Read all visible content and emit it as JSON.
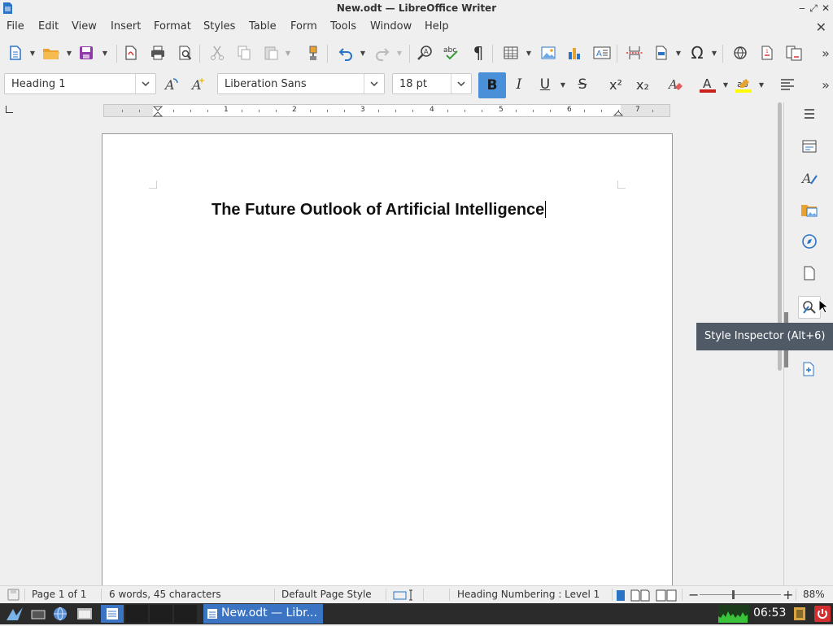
{
  "window": {
    "title": "New.odt — LibreOffice Writer"
  },
  "menubar": {
    "items": [
      "File",
      "Edit",
      "View",
      "Insert",
      "Format",
      "Styles",
      "Table",
      "Form",
      "Tools",
      "Window",
      "Help"
    ]
  },
  "formatting": {
    "paragraph_style": "Heading 1",
    "font_name": "Liberation Sans",
    "font_size": "18 pt",
    "bold_active": true,
    "colors": {
      "bold_active_bg": "#4a90d9",
      "font_color": "#c9211e",
      "highlight_color": "#ffff00"
    }
  },
  "ruler": {
    "numbers": [
      "1",
      "2",
      "3",
      "4",
      "5",
      "6",
      "7"
    ]
  },
  "document": {
    "heading_text": "The Future Outlook of Artificial Intelligence"
  },
  "tooltip": {
    "text": "Style Inspector (Alt+6)"
  },
  "statusbar": {
    "page": "Page 1 of 1",
    "word_count": "6 words, 45 characters",
    "page_style": "Default Page Style",
    "outline": "Heading Numbering : Level 1",
    "zoom": "88%"
  },
  "taskbar": {
    "active_task": "New.odt — Libr...",
    "clock": "06:53"
  },
  "sidebar": {
    "buttons": [
      "sidebar-menu-icon",
      "properties-icon",
      "styles-icon",
      "gallery-icon",
      "navigator-icon",
      "page-icon",
      "style-inspector-icon",
      "manage-changes-icon"
    ]
  }
}
